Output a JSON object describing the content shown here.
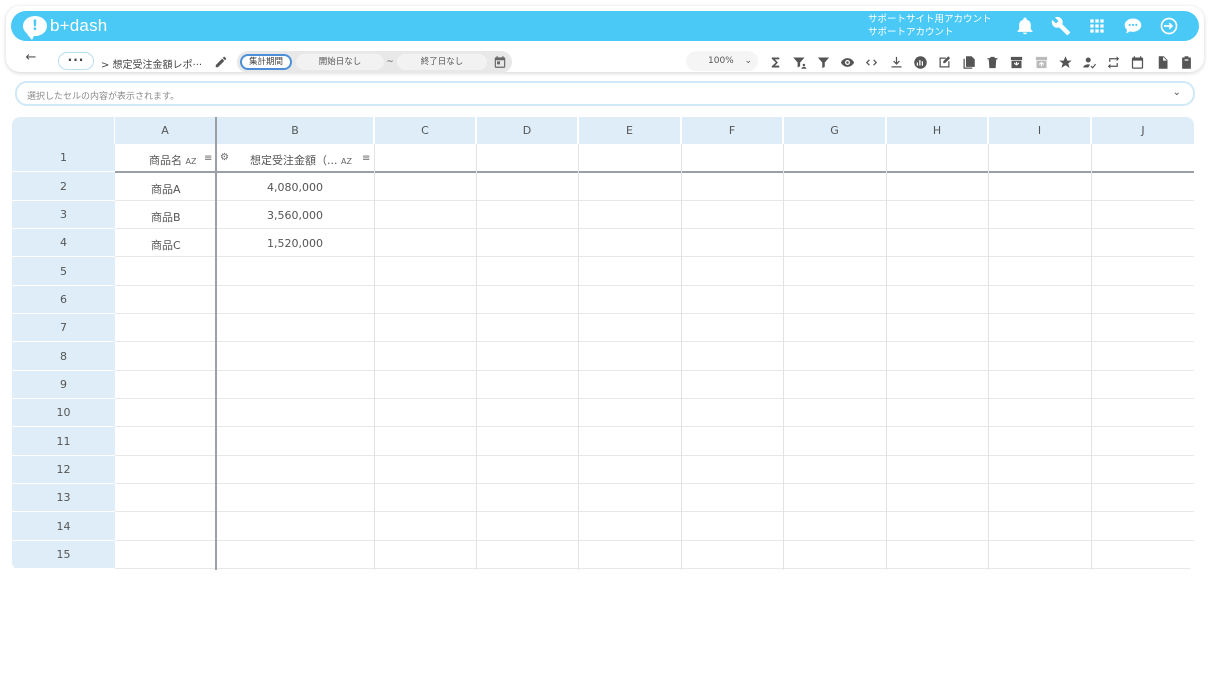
{
  "app": {
    "logo_mark": "!",
    "logo_text": "b+dash",
    "account_line1": "サポートサイト用アカウント",
    "account_line2": "サポートアカウント"
  },
  "toolbar": {
    "back": "←",
    "more": "···",
    "breadcrumb": "> 想定受注金額レポ···",
    "period_active": "集計期間",
    "period_start": "開始日なし",
    "period_tilde": "~",
    "period_end": "終了日なし",
    "zoom": "100%",
    "zoom_caret": "⌄"
  },
  "cellbar": {
    "placeholder": "選択したセルの内容が表示されます。",
    "caret": "⌄"
  },
  "grid": {
    "columns": [
      "A",
      "B",
      "C",
      "D",
      "E",
      "F",
      "G",
      "H",
      "I",
      "J"
    ],
    "rows": [
      "1",
      "2",
      "3",
      "4",
      "5",
      "6",
      "7",
      "8",
      "9",
      "10",
      "11",
      "12",
      "13",
      "14",
      "15"
    ],
    "header_a": "商品名",
    "header_b": "想定受注金額（...",
    "sort_label": "AZ",
    "filter_glyph": "≡",
    "gear_glyph": "⚙",
    "records": [
      {
        "name": "商品A",
        "amount": "4,080,000"
      },
      {
        "name": "商品B",
        "amount": "3,560,000"
      },
      {
        "name": "商品C",
        "amount": "1,520,000"
      }
    ]
  },
  "colors": {
    "brand": "#4ac9f7",
    "header_bg": "#deedf7",
    "active_chip_border": "#4a8fd8"
  }
}
